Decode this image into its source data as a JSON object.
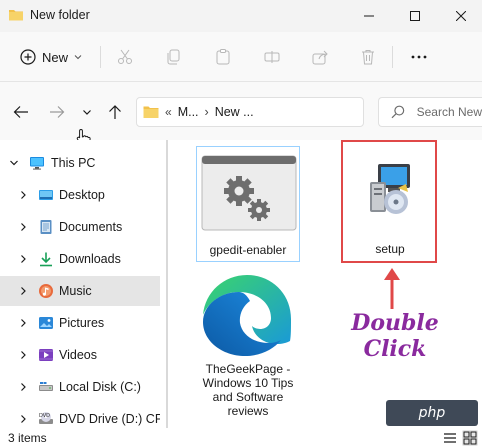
{
  "window": {
    "title": "New folder"
  },
  "commandbar": {
    "new_label": "New"
  },
  "address": {
    "crumbs": [
      "M...",
      "New ..."
    ],
    "search_placeholder": "Search New"
  },
  "navpane": {
    "items": [
      {
        "label": "This PC",
        "icon": "monitor-icon",
        "expanded": true
      },
      {
        "label": "Desktop",
        "icon": "desktop-icon"
      },
      {
        "label": "Documents",
        "icon": "documents-icon"
      },
      {
        "label": "Downloads",
        "icon": "download-icon"
      },
      {
        "label": "Music",
        "icon": "music-icon",
        "selected": true
      },
      {
        "label": "Pictures",
        "icon": "pictures-icon"
      },
      {
        "label": "Videos",
        "icon": "videos-icon"
      },
      {
        "label": "Local Disk (C:)",
        "icon": "drive-icon"
      },
      {
        "label": "DVD Drive (D:) CPR",
        "icon": "dvd-icon"
      }
    ]
  },
  "files": [
    {
      "name": "gpedit-enabler",
      "icon": "gear-app-icon"
    },
    {
      "name": "setup",
      "icon": "installer-icon"
    },
    {
      "name": "TheGeekPage - Windows 10 Tips and Software reviews",
      "icon": "edge-icon"
    }
  ],
  "annotation": {
    "line1": "Double",
    "line2": "Click",
    "color": "#8a2a9e",
    "box_color": "#e04848"
  },
  "watermark": {
    "text": "php"
  },
  "statusbar": {
    "text": "3 items"
  }
}
